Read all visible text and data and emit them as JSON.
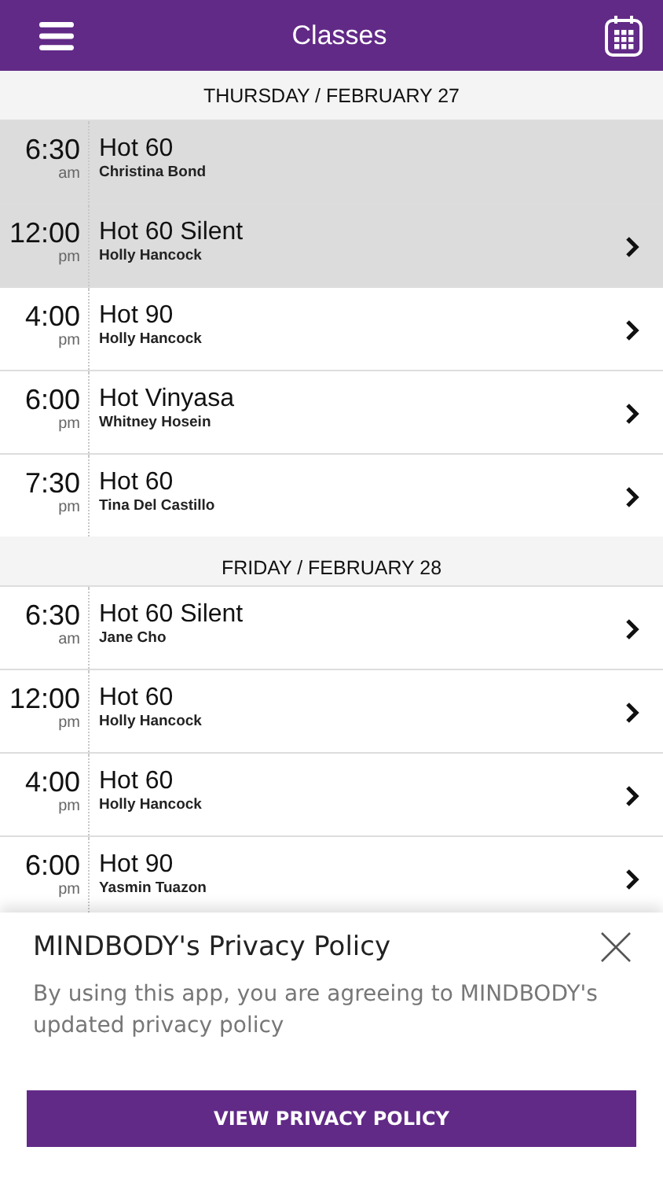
{
  "header": {
    "title": "Classes"
  },
  "days": [
    {
      "label": "THURSDAY / FEBRUARY 27",
      "classes": [
        {
          "time": "6:30",
          "period": "am",
          "name": "Hot 60",
          "teacher": "Christina Bond",
          "past": true,
          "has_details": false
        },
        {
          "time": "12:00",
          "period": "pm",
          "name": "Hot 60 Silent",
          "teacher": "Holly Hancock",
          "past": true,
          "has_details": true
        },
        {
          "time": "4:00",
          "period": "pm",
          "name": "Hot 90",
          "teacher": "Holly Hancock",
          "past": false,
          "has_details": true
        },
        {
          "time": "6:00",
          "period": "pm",
          "name": "Hot Vinyasa",
          "teacher": "Whitney Hosein",
          "past": false,
          "has_details": true
        },
        {
          "time": "7:30",
          "period": "pm",
          "name": "Hot 60",
          "teacher": "Tina Del Castillo",
          "past": false,
          "has_details": true
        }
      ]
    },
    {
      "label": "FRIDAY / FEBRUARY 28",
      "classes": [
        {
          "time": "6:30",
          "period": "am",
          "name": "Hot 60 Silent",
          "teacher": "Jane Cho",
          "past": false,
          "has_details": true
        },
        {
          "time": "12:00",
          "period": "pm",
          "name": "Hot 60",
          "teacher": "Holly Hancock",
          "past": false,
          "has_details": true
        },
        {
          "time": "4:00",
          "period": "pm",
          "name": "Hot 60",
          "teacher": "Holly Hancock",
          "past": false,
          "has_details": true
        },
        {
          "time": "6:00",
          "period": "pm",
          "name": "Hot 90",
          "teacher": "Yasmin Tuazon",
          "past": false,
          "has_details": true
        }
      ]
    }
  ],
  "privacy_sheet": {
    "title": "MINDBODY's Privacy Policy",
    "message": "By using this app, you are agreeing to MINDBODY's updated privacy policy",
    "button": "VIEW PRIVACY POLICY"
  }
}
